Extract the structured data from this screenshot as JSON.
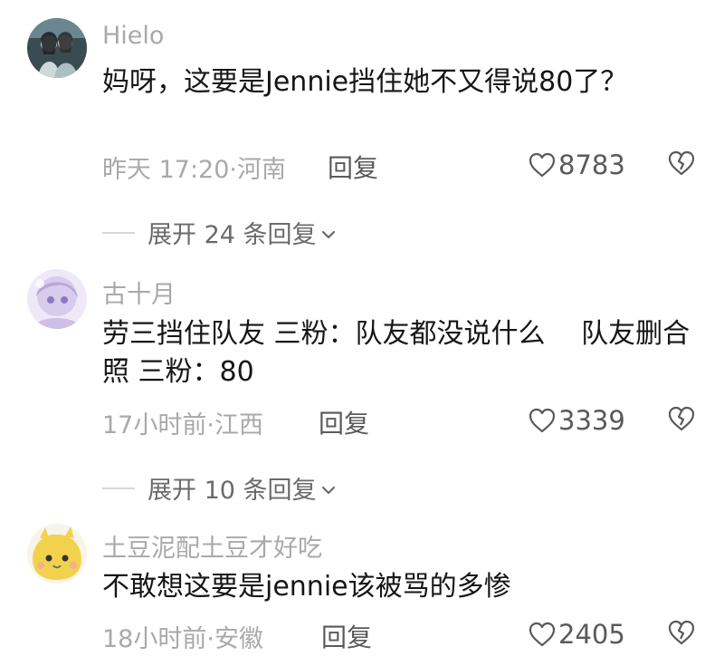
{
  "comments": [
    {
      "username": "Hielo",
      "text": "妈呀，这要是Jennie挡住她不又得说80了？",
      "time": "昨天 17:20·河南",
      "reply_label": "回复",
      "likes": "8783",
      "replies_label": "展开 24 条回复",
      "avatar_colors": {
        "bg": "#3b4b52",
        "fg": "#cfd8da",
        "accent": "#7e9aa4"
      }
    },
    {
      "username": "古十月",
      "text": "劳三挡住队友 三粉：队友都没说什么　 队友删合照 三粉：80",
      "time": "17小时前·江西",
      "reply_label": "回复",
      "likes": "3339",
      "replies_label": "展开 10 条回复",
      "avatar_colors": {
        "bg": "#e6dcf2",
        "fg": "#b9a6da",
        "accent": "#f3eefa"
      }
    },
    {
      "username": "土豆泥配土豆才好吃",
      "text": "不敢想这要是jennie该被骂的多惨",
      "time": "18小时前·安徽",
      "reply_label": "回复",
      "likes": "2405",
      "avatar_colors": {
        "bg": "#f6f2e4",
        "fg": "#f2d24c",
        "accent": "#6b6b6b"
      }
    }
  ],
  "icons": {
    "like": "heart-outline-icon",
    "dislike": "broken-heart-icon",
    "expand": "chevron-down-icon"
  },
  "colors": {
    "text": "#161616",
    "muted": "#a9a9a9",
    "action": "#5a5a5a"
  }
}
